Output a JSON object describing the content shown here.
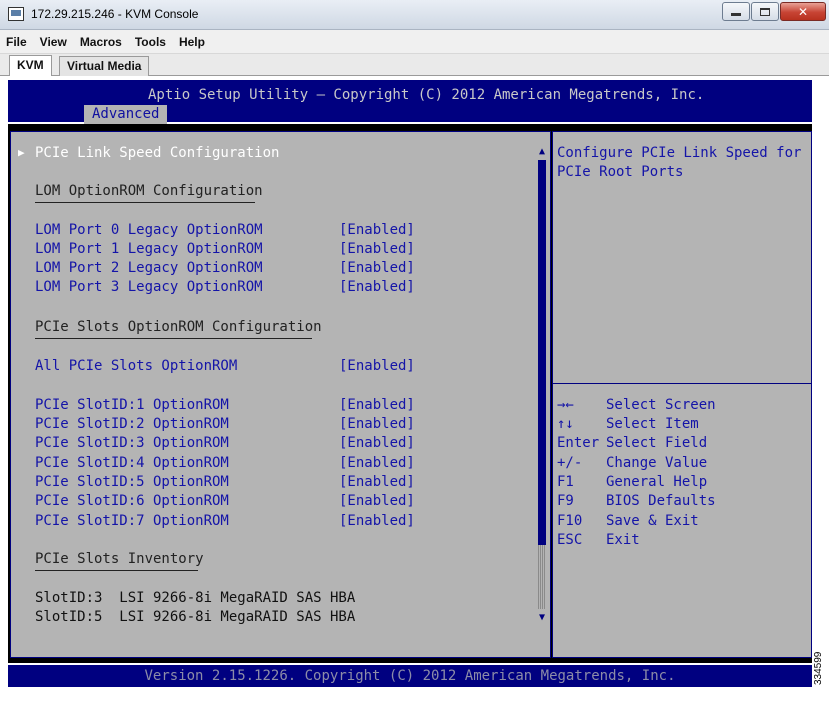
{
  "window": {
    "title": "172.29.215.246 - KVM Console",
    "minimize_label": "",
    "maximize_label": "",
    "close_label": "✕"
  },
  "menubar": [
    "File",
    "View",
    "Macros",
    "Tools",
    "Help"
  ],
  "tabs": [
    "KVM",
    "Virtual Media"
  ],
  "bios": {
    "header_title": "Aptio Setup Utility – Copyright (C) 2012 American Megatrends, Inc.",
    "active_tab": "Advanced",
    "pointer_glyph": "▶",
    "link_speed_item": "PCIe Link Speed Configuration",
    "lom_section": "LOM OptionROM Configuration",
    "lom_items": [
      {
        "label": "LOM Port 0 Legacy OptionROM",
        "value": "[Enabled]"
      },
      {
        "label": "LOM Port 1 Legacy OptionROM",
        "value": "[Enabled]"
      },
      {
        "label": "LOM Port 2 Legacy OptionROM",
        "value": "[Enabled]"
      },
      {
        "label": "LOM Port 3 Legacy OptionROM",
        "value": "[Enabled]"
      }
    ],
    "slots_section": "PCIe Slots OptionROM Configuration",
    "all_slots": {
      "label": "All PCIe Slots OptionROM",
      "value": "[Enabled]"
    },
    "slot_items": [
      {
        "label": "PCIe SlotID:1 OptionROM",
        "value": "[Enabled]"
      },
      {
        "label": "PCIe SlotID:2 OptionROM",
        "value": "[Enabled]"
      },
      {
        "label": "PCIe SlotID:3 OptionROM",
        "value": "[Enabled]"
      },
      {
        "label": "PCIe SlotID:4 OptionROM",
        "value": "[Enabled]"
      },
      {
        "label": "PCIe SlotID:5 OptionROM",
        "value": "[Enabled]"
      },
      {
        "label": "PCIe SlotID:6 OptionROM",
        "value": "[Enabled]"
      },
      {
        "label": "PCIe SlotID:7 OptionROM",
        "value": "[Enabled]"
      }
    ],
    "inventory_section": "PCIe Slots Inventory",
    "inventory": [
      "SlotID:3  LSI 9266-8i MegaRAID SAS HBA",
      "SlotID:5  LSI 9266-8i MegaRAID SAS HBA"
    ],
    "help_lines": [
      "Configure PCIe Link Speed for",
      "PCIe Root Ports"
    ],
    "keys": [
      {
        "key": "→←",
        "desc": "Select Screen"
      },
      {
        "key": "↑↓",
        "desc": "Select Item"
      },
      {
        "key": "Enter",
        "desc": "Select Field"
      },
      {
        "key": "+/-",
        "desc": "Change Value"
      },
      {
        "key": "F1",
        "desc": "General Help"
      },
      {
        "key": "F9",
        "desc": "BIOS Defaults"
      },
      {
        "key": "F10",
        "desc": "Save & Exit"
      },
      {
        "key": "ESC",
        "desc": "Exit"
      }
    ],
    "scroll_up_glyph": "▲",
    "scroll_down_glyph": "▼",
    "footer": "Version 2.15.1226. Copyright (C) 2012 American Megatrends, Inc."
  },
  "side_label": "334599",
  "colors": {
    "bios_blue": "#000080",
    "bios_gray": "#b4b4b4",
    "item_blue": "#1414a8",
    "highlight": "#ffffff"
  }
}
